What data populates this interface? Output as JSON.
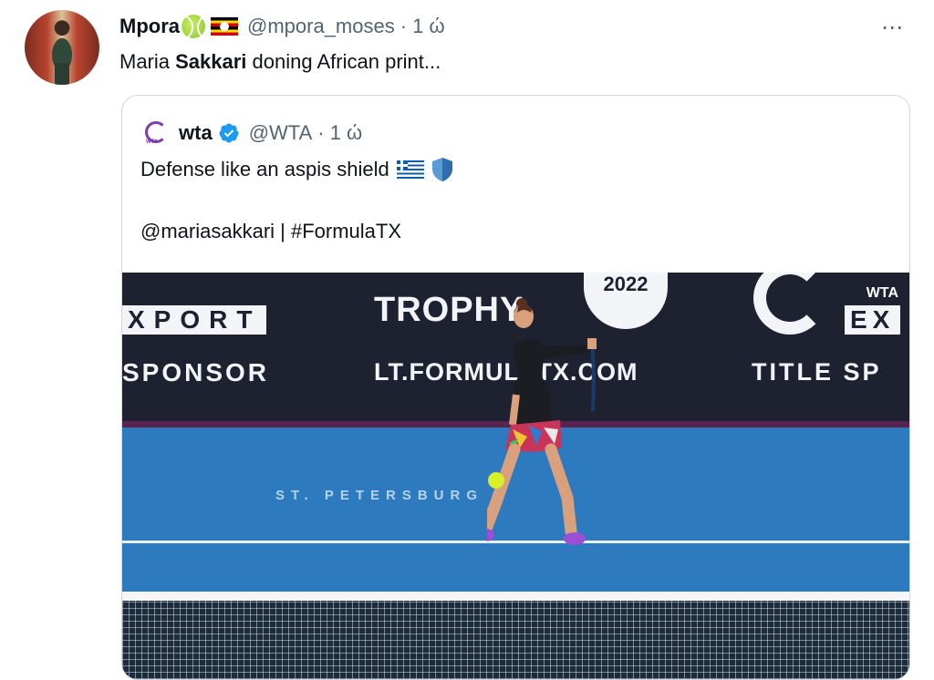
{
  "tweet": {
    "display_name": "Mpora",
    "handle": "@mpora_moses",
    "time": "· 1 ώ",
    "text_before": "Maria ",
    "text_bold": "Sakkari",
    "text_after": " doning African print...",
    "more_icon": "⋯"
  },
  "quoted": {
    "display_name": "wta",
    "handle": "@WTA",
    "time": "· 1 ώ",
    "line1": "Defense like an aspis shield",
    "line2": "@mariasakkari | #FormulaTX"
  },
  "video": {
    "ad_export_left": "XPORT",
    "ad_sponsor": "SPONSOR",
    "ad_trophy": "TROPHY",
    "ad_year": "2022",
    "ad_url": "LT.FORMULATX.COM",
    "ad_title_sponsor": "TITLE SP",
    "ad_ex": "EX",
    "watermark": "WTA",
    "court_text": "ST. PETERSBURG"
  },
  "colors": {
    "handle_gray": "#536471",
    "verified_blue": "#1d9bf0",
    "wta_purple": "#7d3ca8",
    "court_blue": "#2d7bbe"
  }
}
